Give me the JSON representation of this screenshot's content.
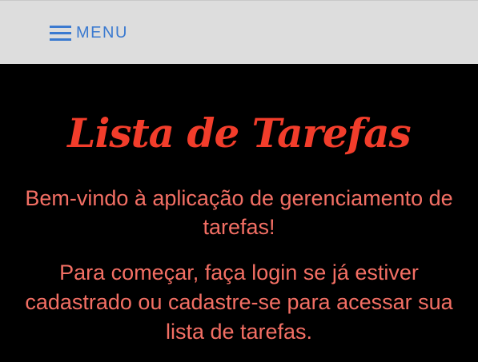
{
  "nav": {
    "menu_label": "MENU",
    "menu_icon": "hamburger-menu-icon"
  },
  "main": {
    "title": "Lista de Tarefas",
    "welcome": "Bem-vindo à aplicação de gerenciamento de tarefas!",
    "instructions": "Para começar, faça login se já estiver cadastrado ou cadastre-se para acessar sua lista de tarefas."
  },
  "colors": {
    "topbar_background": "#dddddd",
    "menu_accent": "#3b7ad0",
    "page_background": "#000000",
    "title": "#f23d2b",
    "body_text": "#f36f64"
  }
}
